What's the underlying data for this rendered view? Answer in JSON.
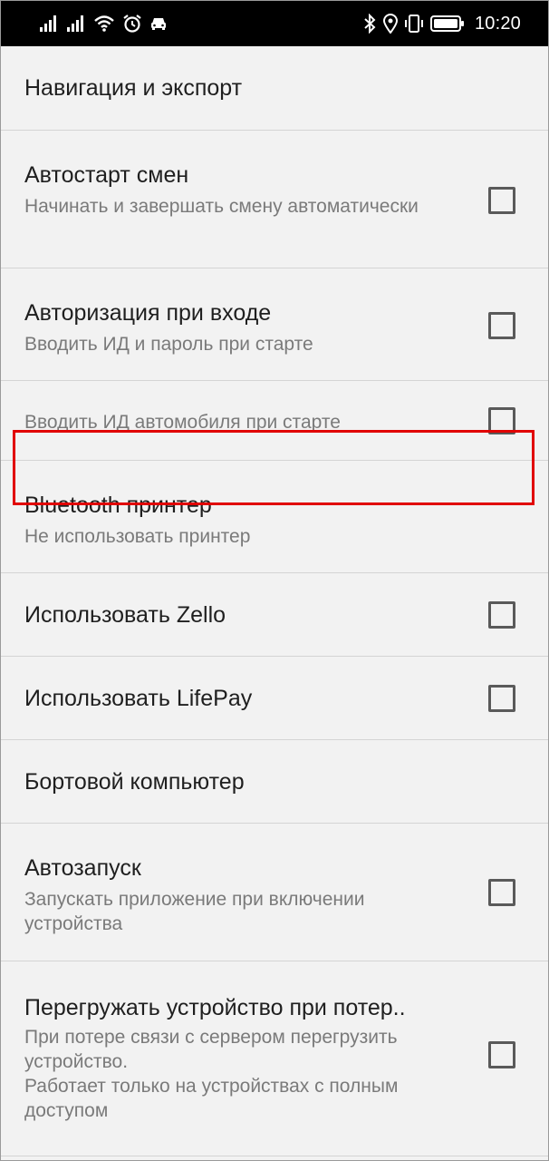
{
  "status_bar": {
    "time": "10:20",
    "left_icons": [
      "signal-1-icon",
      "signal-2-icon",
      "wifi-icon",
      "alarm-icon",
      "car-icon"
    ],
    "right_icons": [
      "bluetooth-icon",
      "location-icon",
      "vibrate-icon",
      "battery-icon"
    ]
  },
  "settings": {
    "navigation_export": {
      "title": "Навигация и экспорт"
    },
    "auto_shift": {
      "title": "Автостарт смен",
      "summary": "Начинать и завершать смену автоматически",
      "checked": false
    },
    "login_auth": {
      "title": "Авторизация при входе",
      "summary": "Вводить ИД и пароль при старте",
      "checked": false
    },
    "vehicle_id": {
      "summary": "Вводить ИД автомобиля при старте",
      "checked": false
    },
    "bluetooth_printer": {
      "title": "Bluetooth принтер",
      "summary": "Не использовать принтер"
    },
    "use_zello": {
      "title": "Использовать Zello",
      "checked": false
    },
    "use_lifepay": {
      "title": "Использовать LifePay",
      "checked": false
    },
    "onboard_computer": {
      "title": "Бортовой компьютер"
    },
    "autostart": {
      "title": "Автозапуск",
      "summary": "Запускать приложение при включении устройства",
      "checked": false
    },
    "reboot_on_loss": {
      "title": "Перегружать устройство при потер..",
      "summary_line1": "При потере связи с сервером перегрузить устройство.",
      "summary_line2": "Работает только на устройствах с полным доступом",
      "checked": false
    }
  },
  "accent": {
    "highlight_color": "#e10000"
  }
}
